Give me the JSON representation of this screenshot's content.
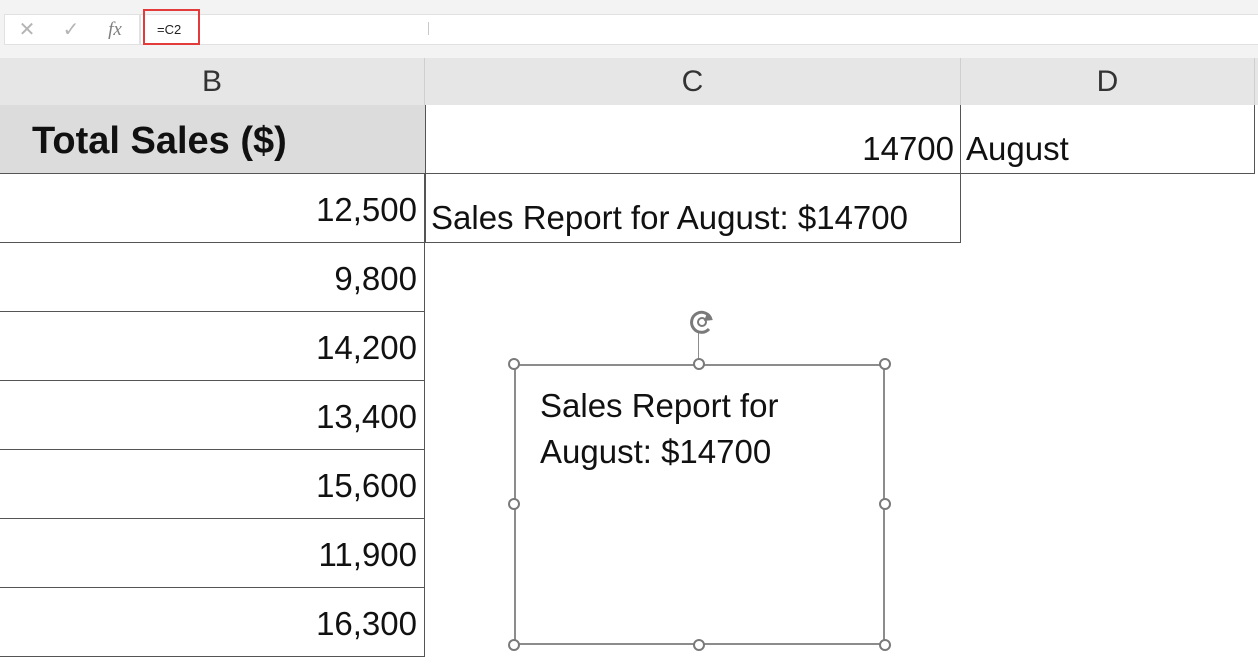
{
  "formula_bar": {
    "cancel_icon": "✕",
    "enter_icon": "✓",
    "fx_label": "fx",
    "formula": "=C2",
    "highlight_color": "#e33b3b"
  },
  "columns": {
    "b": "B",
    "c": "C",
    "d": "D"
  },
  "sheet": {
    "b_header": "Total Sales ($)",
    "b_values": [
      "12,500",
      "9,800",
      "14,200",
      "13,400",
      "15,600",
      "11,900",
      "16,300"
    ],
    "c1": "14700",
    "d1": "August",
    "c2": "Sales Report for August: $14700"
  },
  "textbox": {
    "line1": "Sales Report for",
    "line2": "August: $14700"
  },
  "icons": {
    "rotate": "rotate-handle-icon"
  }
}
